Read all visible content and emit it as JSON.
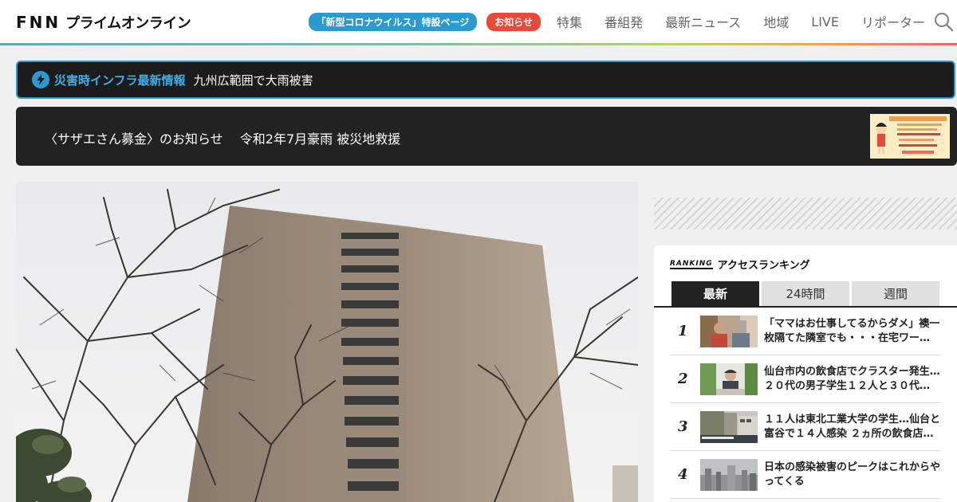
{
  "header": {
    "logo_fnn": "FNN",
    "logo_text": "プライムオンライン",
    "corona_pill": "「新型コロナウイルス」特設ページ",
    "notice_pill": "お知らせ",
    "nav": [
      "特集",
      "番組発",
      "最新ニュース",
      "地域",
      "LIVE",
      "リポーター"
    ],
    "search_icon": "search-icon"
  },
  "alert": {
    "label": "災害時インフラ最新情報",
    "text": "九州広範囲で大雨被害",
    "icon": "bolt-icon"
  },
  "banner": {
    "text": "〈サザエさん募金〉のお知らせ　 令和2年7月豪雨 被災地救援"
  },
  "ranking": {
    "logo": "RANKING",
    "title": "アクセスランキング",
    "tabs": [
      "最新",
      "24時間",
      "週間"
    ],
    "items": [
      {
        "rank": "1",
        "title": "「ママはお仕事してるからダメ」襖一枚隔てた隣室でも・・・在宅ワー…"
      },
      {
        "rank": "2",
        "title": "仙台市内の飲食店でクラスター発生…２０代の男子学生１２人と３０代…"
      },
      {
        "rank": "3",
        "title": "１１人は東北工業大学の学生…仙台と富谷で１４人感染 ２ヵ所の飲食店…"
      },
      {
        "rank": "4",
        "title": "日本の感染被害のピークはこれからやってくる"
      }
    ]
  },
  "colors": {
    "accent_blue": "#2a9bd1",
    "notice_red": "#e84a3a",
    "dark_bg": "#1c1c1c"
  }
}
